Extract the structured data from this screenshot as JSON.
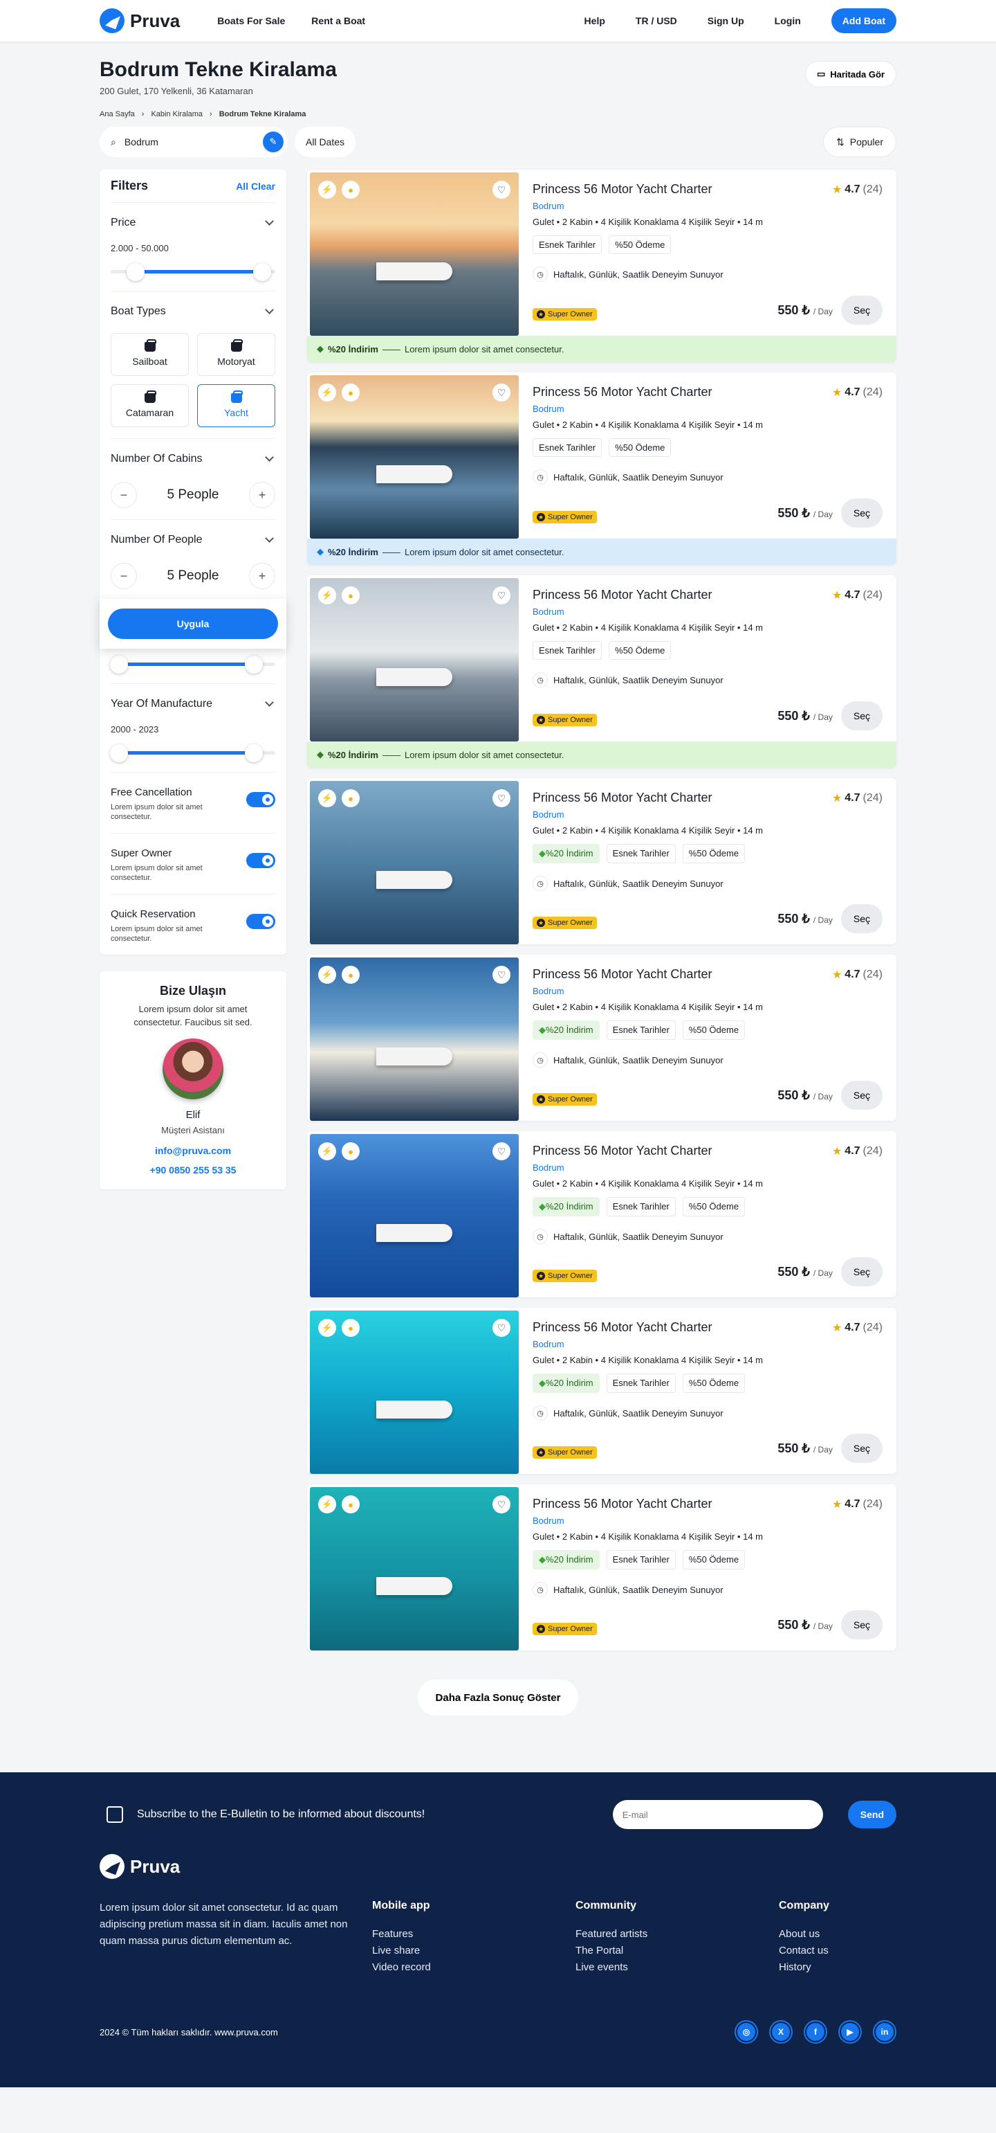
{
  "nav": {
    "brand": "Pruva",
    "links": [
      "Boats For Sale",
      "Rent a Boat"
    ],
    "right": [
      "Help",
      "TR / USD",
      "Sign Up",
      "Login"
    ],
    "cta": "Add Boat"
  },
  "header": {
    "title": "Bodrum Tekne Kiralama",
    "subtitle": "200 Gulet, 170 Yelkenli, 36 Katamaran",
    "map_button": "Haritada Gör",
    "breadcrumb": [
      "Ana Sayfa",
      "Kabin Kiralama",
      "Bodrum  Tekne Kiralama"
    ]
  },
  "search": {
    "location": "Bodrum",
    "dates": "All Dates",
    "sort": "Populer"
  },
  "filters": {
    "title": "Filters",
    "clear": "All Clear",
    "price_title": "Price",
    "price_range": "2.000 - 50.000",
    "price_slider": [
      0.15,
      0.92
    ],
    "boat_types_title": "Boat Types",
    "boat_types": [
      "Sailboat",
      "Motoryat",
      "Catamaran",
      "Yacht"
    ],
    "boat_type_active": "Yacht",
    "cabins_title": "Number Of Cabins",
    "cabins_value": "5 People",
    "people_title": "Number Of People",
    "people_value": "5 People",
    "apply": "Uygula",
    "extra_slider": [
      0.05,
      0.87
    ],
    "year_title": "Year  Of Manufacture",
    "year_range": "2000 - 2023",
    "year_slider": [
      0.05,
      0.87
    ],
    "toggles": [
      {
        "title": "Free Cancellation",
        "desc": "Lorem ipsum dolor sit amet consectetur."
      },
      {
        "title": "Super Owner",
        "desc": "Lorem ipsum dolor sit amet consectetur."
      },
      {
        "title": "Quick Reservation",
        "desc": "Lorem ipsum dolor sit amet consectetur."
      }
    ]
  },
  "contact": {
    "title": "Bize Ulaşın",
    "desc": "Lorem ipsum dolor sit amet consectetur. Faucibus sit sed.",
    "name": "Elif",
    "role": "Müşteri Asistanı",
    "email": "info@pruva.com",
    "phone": "+90 0850 255 53 35"
  },
  "card_common": {
    "title": "Princess 56 Motor Yacht Charter",
    "location": "Bodrum",
    "specs": "Gulet  •  2 Kabin  •  4 Kişilik Konaklama  4 Kişilik Seyir  •  14 m",
    "rating": "4.7",
    "rating_count": "(24)",
    "offer": "Haftalık, Günlük, Saatlik Deneyim Sunuyor",
    "owner": "Super Owner",
    "price": "550 ₺",
    "price_unit": "/ Day",
    "select": "Seç",
    "discount_chip": "%20 İndirim",
    "chip_flexible": "Esnek Tarihler",
    "chip_payment": "%50 Ödeme",
    "promo_tag": "%20 İndirim",
    "promo_text": "Lorem ipsum dolor sit amet consectetur."
  },
  "cards": [
    {
      "promo": "green",
      "discount_chip": false
    },
    {
      "promo": "blue",
      "discount_chip": false
    },
    {
      "promo": "green",
      "discount_chip": false
    },
    {
      "promo": "",
      "discount_chip": true
    },
    {
      "promo": "",
      "discount_chip": true
    },
    {
      "promo": "",
      "discount_chip": true
    },
    {
      "promo": "",
      "discount_chip": true
    },
    {
      "promo": "",
      "discount_chip": true
    }
  ],
  "more_button": "Daha Fazla Sonuç Göster",
  "footer": {
    "newsletter": "Subscribe to the E-Bulletin to be informed about discounts!",
    "email_placeholder": "E-mail",
    "send": "Send",
    "brand": "Pruva",
    "desc": "Lorem ipsum dolor sit amet consectetur. Id ac quam adipiscing pretium massa sit in diam. Iaculis amet non quam massa purus dictum elementum ac.",
    "columns": [
      {
        "title": "Mobile app",
        "items": [
          "Features",
          "Live share",
          "Video record"
        ]
      },
      {
        "title": "Community",
        "items": [
          "Featured artists",
          "The Portal",
          "Live events"
        ]
      },
      {
        "title": "Company",
        "items": [
          "About us",
          "Contact us",
          "History"
        ]
      }
    ],
    "copyright": "2024 © Tüm hakları saklıdır.  www.pruva.com",
    "social": [
      "instagram-icon",
      "x-icon",
      "facebook-icon",
      "youtube-icon",
      "linkedin-icon"
    ],
    "social_glyphs": [
      "◎",
      "X",
      "f",
      "▶",
      "in"
    ]
  },
  "colors": {
    "accent": "#1677f0",
    "footer_bg": "#0f2247",
    "owner": "#f6c21b"
  }
}
